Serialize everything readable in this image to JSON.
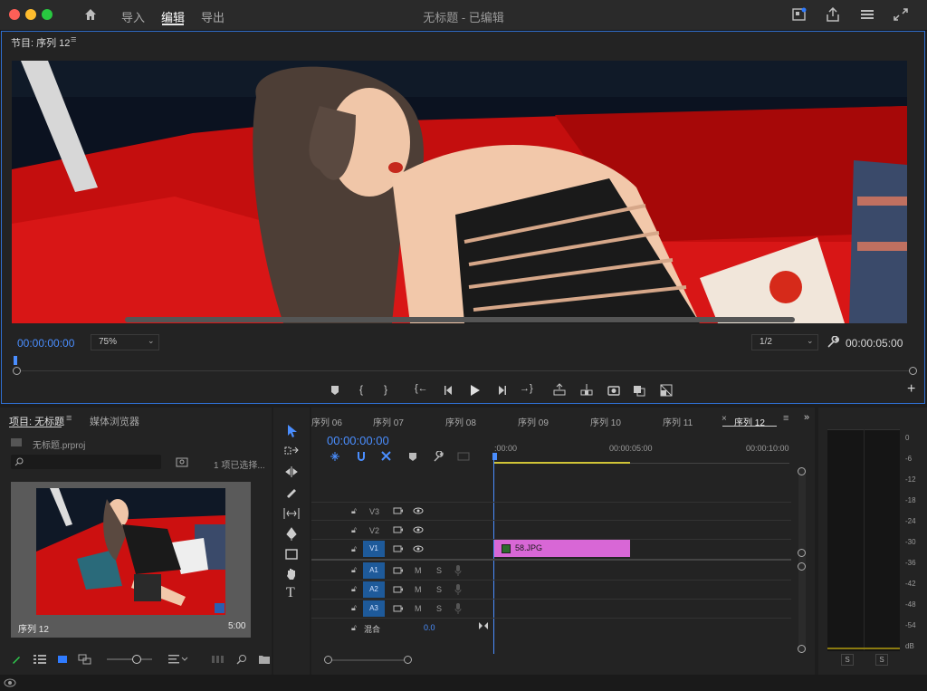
{
  "window": {
    "title": "无标题 - 已编辑",
    "nav": {
      "home": "home-icon",
      "import": "导入",
      "edit": "编辑",
      "export": "导出"
    }
  },
  "program_monitor": {
    "title": "节目: 序列 12",
    "timecode_current": "00:00:00:00",
    "zoom": "75%",
    "resolution": "1/2",
    "timecode_duration": "00:00:05:00"
  },
  "project_panel": {
    "tab_project": "项目: 无标题",
    "tab_media": "媒体浏览器",
    "file": "无标题.prproj",
    "selection": "1 项已选择...",
    "item_name": "序列 12",
    "item_duration": "5:00"
  },
  "timeline": {
    "tabs": [
      "序列 06",
      "序列 07",
      "序列 08",
      "序列 09",
      "序列 10",
      "序列 11",
      "序列 12"
    ],
    "active_tab": "序列 12",
    "timecode": "00:00:00:00",
    "ruler": [
      ":00:00",
      "00:00:05:00",
      "00:00:10:00"
    ],
    "tracks": {
      "v3": "V3",
      "v2": "V2",
      "v1": "V1",
      "a1": "A1",
      "a2": "A2",
      "a3": "A3",
      "m": "M",
      "s": "S",
      "mix_label": "混合",
      "mix_value": "0.0"
    },
    "clip": "58.JPG"
  },
  "meters": {
    "scale": [
      "0",
      "-6",
      "-12",
      "-18",
      "-24",
      "-30",
      "-36",
      "-42",
      "-48",
      "-54",
      "dB"
    ],
    "solo": [
      "S",
      "S"
    ]
  },
  "colors": {
    "accent_blue": "#2f6fd1",
    "timecode_blue": "#4a8eff",
    "clip_pink": "#d867d6",
    "track_blue": "#1e5a9a"
  }
}
